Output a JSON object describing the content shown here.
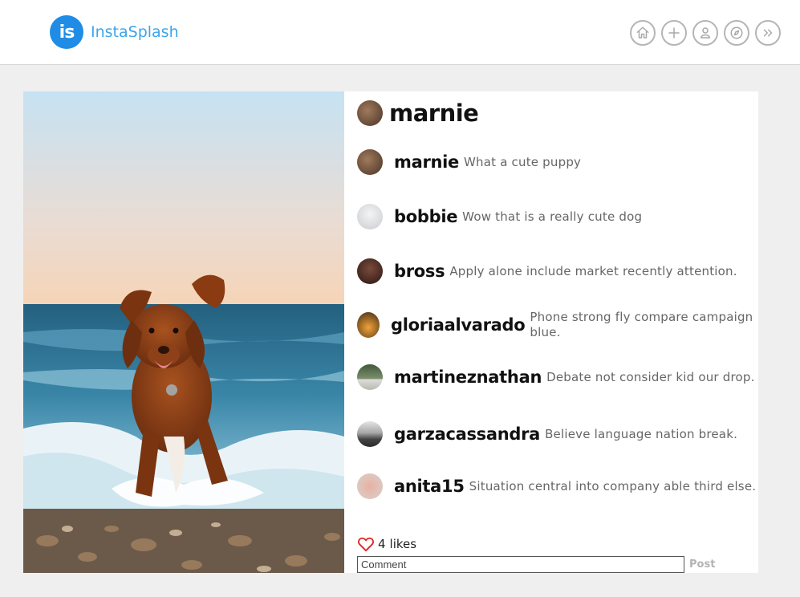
{
  "app": {
    "logo_text": "is",
    "name": "InstaSplash"
  },
  "nav": {
    "buttons": [
      {
        "icon": "home-icon"
      },
      {
        "icon": "plus-icon"
      },
      {
        "icon": "user-icon"
      },
      {
        "icon": "compass-icon"
      },
      {
        "icon": "double-chevron-right-icon"
      }
    ]
  },
  "post": {
    "author": "marnie",
    "image_description": "",
    "likes_count": "4",
    "likes_label": "likes",
    "comment_placeholder": "Comment",
    "post_label": "Post",
    "comments": [
      {
        "user": "marnie",
        "text": "What a cute puppy"
      },
      {
        "user": "bobbie",
        "text": "Wow that is a really cute dog"
      },
      {
        "user": "bross",
        "text": "Apply alone include market recently attention."
      },
      {
        "user": "gloriaalvarado",
        "text": "Phone strong fly compare campaign blue."
      },
      {
        "user": "martineznathan",
        "text": "Debate not consider kid our drop."
      },
      {
        "user": "garzacassandra",
        "text": "Believe language nation break."
      },
      {
        "user": "anita15",
        "text": "Situation central into company able third else."
      }
    ]
  },
  "colors": {
    "brand": "#1f8ce6",
    "brand_text": "#3da5ea",
    "like_heart": "#e02424",
    "background": "#efefef"
  }
}
